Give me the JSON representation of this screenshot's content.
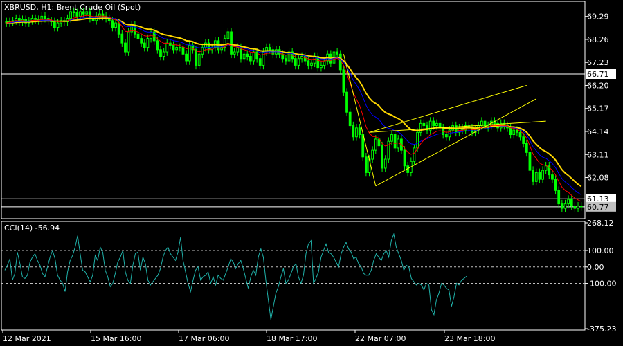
{
  "window": {
    "symbol_label": "XBRUSD, H1:  Brent Crude Oil (Spot)"
  },
  "colors": {
    "background": "#000000",
    "frame": "#ffffff",
    "bull_candle": "#00ff00",
    "bear_candle": "#000000",
    "ma_fast": "#ff0000",
    "ma_mid": "#0000ff",
    "ma_slow": "#ffd700",
    "trendline": "#ffff00",
    "cci_line": "#20b2aa",
    "level_line": "#ffffff",
    "tag_bg": "#ffffff",
    "tag_bg_current": "#c0c0c0"
  },
  "chart_data": [
    {
      "type": "candlestick",
      "panel": "main",
      "ylim": [
        60.3,
        69.9
      ],
      "price_ticks": [
        "69.29",
        "68.26",
        "67.23",
        "66.20",
        "65.17",
        "64.14",
        "63.11",
        "62.08"
      ],
      "time_ticks": [
        "12 Mar 2021",
        "15 Mar 16:00",
        "17 Mar 06:00",
        "18 Mar 17:00",
        "22 Mar 07:00",
        "23 Mar 18:00"
      ],
      "close": [
        69.0,
        69.05,
        69.1,
        69.2,
        69.05,
        69.15,
        69.0,
        69.1,
        69.2,
        69.15,
        69.1,
        69.3,
        69.2,
        69.1,
        69.05,
        68.8,
        69.0,
        69.1,
        69.05,
        69.2,
        69.5,
        69.45,
        69.3,
        69.5,
        69.4,
        69.5,
        69.2,
        69.1,
        69.3,
        69.4,
        69.3,
        69.2,
        69.1,
        68.8,
        69.0,
        68.5,
        68.1,
        67.7,
        68.6,
        68.9,
        68.5,
        68.3,
        68.1,
        67.9,
        68.3,
        68.6,
        68.2,
        67.8,
        67.5,
        67.7,
        68.1,
        68.0,
        67.8,
        67.9,
        67.9,
        67.6,
        67.3,
        68.0,
        67.8,
        67.1,
        67.6,
        67.9,
        68.1,
        67.8,
        67.9,
        68.2,
        67.8,
        67.9,
        68.3,
        68.6,
        67.6,
        67.7,
        67.9,
        67.4,
        67.6,
        67.5,
        67.3,
        67.7,
        67.4,
        67.1,
        67.7,
        67.9,
        67.8,
        67.6,
        67.8,
        67.6,
        67.4,
        67.3,
        67.7,
        67.4,
        67.1,
        67.4,
        67.5,
        67.3,
        67.1,
        67.2,
        67.5,
        67.0,
        67.1,
        67.3,
        67.6,
        67.2,
        67.7,
        67.6,
        66.9,
        65.9,
        65.0,
        64.4,
        63.9,
        64.3,
        64.0,
        63.0,
        62.3,
        62.9,
        63.3,
        63.8,
        63.5,
        62.5,
        62.9,
        63.7,
        64.0,
        63.4,
        63.8,
        63.3,
        62.6,
        62.3,
        62.8,
        63.4,
        64.1,
        64.5,
        64.4,
        64.2,
        64.6,
        64.4,
        64.5,
        64.3,
        64.0,
        63.9,
        64.2,
        64.4,
        64.1,
        64.3,
        64.2,
        64.4,
        64.3,
        64.1,
        64.2,
        64.4,
        64.6,
        64.3,
        64.4,
        64.6,
        64.5,
        64.3,
        64.5,
        64.4,
        64.3,
        64.0,
        64.2,
        64.1,
        63.9,
        63.6,
        63.2,
        62.4,
        61.9,
        62.3,
        62.0,
        62.4,
        62.6,
        62.2,
        62.0,
        61.5,
        60.9,
        60.7,
        60.9,
        61.1,
        60.8,
        60.7,
        60.8,
        60.77
      ],
      "ma_fast": [
        69.0,
        69.03,
        69.06,
        69.1,
        69.09,
        69.1,
        69.08,
        69.08,
        69.11,
        69.12,
        69.12,
        69.15,
        69.16,
        69.15,
        69.13,
        69.07,
        69.06,
        69.07,
        69.07,
        69.09,
        69.16,
        69.22,
        69.24,
        69.29,
        69.31,
        69.34,
        69.32,
        69.28,
        69.29,
        69.31,
        69.31,
        69.29,
        69.26,
        69.17,
        69.14,
        69.02,
        68.84,
        68.62,
        68.61,
        68.66,
        68.64,
        68.59,
        68.51,
        68.42,
        68.4,
        68.44,
        68.4,
        68.3,
        68.17,
        68.09,
        68.09,
        68.07,
        68.03,
        68.01,
        67.99,
        67.93,
        67.84,
        67.87,
        67.86,
        67.74,
        67.71,
        67.74,
        67.8,
        67.8,
        67.82,
        67.88,
        67.86,
        67.87,
        67.94,
        68.05,
        67.97,
        67.93,
        67.92,
        67.84,
        67.8,
        67.76,
        67.69,
        67.69,
        67.65,
        67.56,
        67.58,
        67.63,
        67.65,
        67.64,
        67.66,
        67.65,
        67.6,
        67.55,
        67.58,
        67.55,
        67.48,
        67.46,
        67.47,
        67.44,
        67.39,
        67.36,
        67.38,
        67.32,
        67.29,
        67.29,
        67.34,
        67.32,
        67.38,
        67.41,
        67.33,
        67.09,
        66.73,
        66.3,
        65.88,
        65.58,
        65.29,
        64.86,
        64.35,
        64.07,
        63.92,
        63.9,
        63.84,
        63.6,
        63.49,
        63.54,
        63.64,
        63.6,
        63.63,
        63.56,
        63.39,
        63.21,
        63.12,
        63.17,
        63.36,
        63.59,
        63.76,
        63.86,
        64.0,
        64.07,
        64.15,
        64.17,
        64.14,
        64.1,
        64.12,
        64.17,
        64.16,
        64.19,
        64.19,
        64.23,
        64.25,
        64.22,
        64.22,
        64.25,
        64.32,
        64.32,
        64.34,
        64.4,
        64.42,
        64.4,
        64.42,
        64.41,
        64.39,
        64.3,
        64.28,
        64.23,
        64.16,
        64.04,
        63.85,
        63.5,
        63.12,
        62.93,
        62.73,
        62.65,
        62.63,
        62.53,
        62.41,
        62.2,
        61.9,
        61.65,
        61.5,
        61.42,
        61.28,
        61.16,
        61.08,
        61.01
      ],
      "ma_mid": [
        69.0,
        69.01,
        69.02,
        69.05,
        69.05,
        69.06,
        69.06,
        69.06,
        69.08,
        69.09,
        69.09,
        69.11,
        69.12,
        69.12,
        69.12,
        69.09,
        69.08,
        69.08,
        69.08,
        69.09,
        69.13,
        69.16,
        69.17,
        69.21,
        69.23,
        69.26,
        69.25,
        69.24,
        69.24,
        69.26,
        69.26,
        69.26,
        69.24,
        69.2,
        69.18,
        69.11,
        69.0,
        68.85,
        68.83,
        68.84,
        68.81,
        68.77,
        68.7,
        68.62,
        68.59,
        68.59,
        68.55,
        68.47,
        68.37,
        68.3,
        68.28,
        68.25,
        68.21,
        68.18,
        68.15,
        68.1,
        68.02,
        68.02,
        68.0,
        67.91,
        67.88,
        67.88,
        67.9,
        67.9,
        67.9,
        67.93,
        67.92,
        67.92,
        67.96,
        68.02,
        67.98,
        67.95,
        67.95,
        67.89,
        67.86,
        67.83,
        67.78,
        67.77,
        67.74,
        67.67,
        67.68,
        67.7,
        67.71,
        67.7,
        67.71,
        67.7,
        67.67,
        67.64,
        67.64,
        67.62,
        67.57,
        67.55,
        67.55,
        67.52,
        67.48,
        67.46,
        67.46,
        67.42,
        67.39,
        67.38,
        67.4,
        67.38,
        67.41,
        67.43,
        67.38,
        67.24,
        67.01,
        66.74,
        66.44,
        66.22,
        66.0,
        65.68,
        65.31,
        65.06,
        64.87,
        64.78,
        64.68,
        64.48,
        64.34,
        64.28,
        64.25,
        64.16,
        64.12,
        64.02,
        63.86,
        63.7,
        63.59,
        63.56,
        63.61,
        63.7,
        63.77,
        63.82,
        63.9,
        63.95,
        64.01,
        64.04,
        64.04,
        64.03,
        64.05,
        64.09,
        64.09,
        64.12,
        64.13,
        64.16,
        64.18,
        64.17,
        64.17,
        64.2,
        64.25,
        64.26,
        64.27,
        64.32,
        64.34,
        64.34,
        64.36,
        64.36,
        64.36,
        64.31,
        64.3,
        64.27,
        64.22,
        64.13,
        63.99,
        63.74,
        63.46,
        63.28,
        63.1,
        62.99,
        62.94,
        62.83,
        62.71,
        62.52,
        62.26,
        62.03,
        61.88,
        61.78,
        61.64,
        61.5,
        61.4,
        61.31
      ],
      "ma_slow": [
        69.0,
        69.01,
        69.01,
        69.03,
        69.03,
        69.04,
        69.04,
        69.04,
        69.05,
        69.06,
        69.07,
        69.08,
        69.09,
        69.09,
        69.09,
        69.08,
        69.07,
        69.07,
        69.07,
        69.08,
        69.1,
        69.12,
        69.13,
        69.15,
        69.17,
        69.19,
        69.19,
        69.19,
        69.19,
        69.2,
        69.21,
        69.21,
        69.2,
        69.18,
        69.17,
        69.12,
        69.05,
        68.95,
        68.92,
        68.92,
        68.89,
        68.86,
        68.81,
        68.75,
        68.72,
        68.71,
        68.67,
        68.61,
        68.53,
        68.48,
        68.45,
        68.42,
        68.38,
        68.35,
        68.32,
        68.27,
        68.2,
        68.19,
        68.16,
        68.09,
        68.05,
        68.04,
        68.04,
        68.03,
        68.02,
        68.03,
        68.02,
        68.01,
        68.03,
        68.07,
        68.03,
        68.01,
        68.0,
        67.95,
        67.92,
        67.89,
        67.85,
        67.84,
        67.81,
        67.75,
        67.74,
        67.75,
        67.75,
        67.74,
        67.74,
        67.73,
        67.7,
        67.67,
        67.67,
        67.65,
        67.61,
        67.59,
        67.58,
        67.55,
        67.52,
        67.5,
        67.49,
        67.46,
        67.43,
        67.42,
        67.43,
        67.41,
        67.43,
        67.44,
        67.41,
        67.31,
        67.14,
        66.94,
        66.72,
        66.54,
        66.37,
        66.13,
        65.85,
        65.64,
        65.48,
        65.39,
        65.29,
        65.12,
        64.99,
        64.92,
        64.87,
        64.78,
        64.72,
        64.63,
        64.49,
        64.34,
        64.23,
        64.18,
        64.17,
        64.2,
        64.22,
        64.24,
        64.27,
        64.29,
        64.32,
        64.32,
        64.3,
        64.28,
        64.28,
        64.29,
        64.28,
        64.29,
        64.29,
        64.3,
        64.31,
        64.3,
        64.29,
        64.3,
        64.33,
        64.33,
        64.34,
        64.37,
        64.38,
        64.38,
        64.39,
        64.39,
        64.38,
        64.35,
        64.34,
        64.32,
        64.28,
        64.21,
        64.11,
        63.93,
        63.72,
        63.57,
        63.42,
        63.31,
        63.24,
        63.14,
        63.02,
        62.86,
        62.64,
        62.43,
        62.28,
        62.17,
        62.04,
        61.9,
        61.78,
        61.68
      ],
      "trendlines": [
        {
          "from": [
            105,
            67.6
          ],
          "to": [
            115,
            61.7
          ]
        },
        {
          "from": [
            115,
            61.7
          ],
          "to": [
            165,
            65.6
          ]
        },
        {
          "from": [
            113,
            64.1
          ],
          "to": [
            168,
            64.6
          ]
        },
        {
          "from": [
            113,
            64.1
          ],
          "to": [
            162,
            66.2
          ]
        }
      ],
      "levels": [
        {
          "price": 66.71,
          "tag": "66.71",
          "current": false
        },
        {
          "price": 61.13,
          "tag": "61.13",
          "current": false
        },
        {
          "price": 60.77,
          "tag": "60.77",
          "current": true
        }
      ]
    },
    {
      "type": "line",
      "panel": "indicator",
      "title": "CCI(14) -56.94",
      "ylim": [
        -375.23,
        268.12
      ],
      "ticks": [
        "268.12",
        "100.00",
        "0.00",
        "-100.00",
        "-375.23"
      ],
      "levels": [
        100,
        0,
        -100
      ],
      "values": [
        -20,
        10,
        50,
        -80,
        -40,
        90,
        20,
        -60,
        -70,
        -50,
        30,
        60,
        80,
        40,
        10,
        -40,
        -60,
        0,
        60,
        100,
        50,
        -50,
        -80,
        -100,
        -150,
        -30,
        40,
        70,
        120,
        190,
        80,
        -20,
        -30,
        -60,
        -90,
        -50,
        70,
        40,
        120,
        90,
        -20,
        -60,
        -120,
        -100,
        -40,
        30,
        60,
        100,
        -30,
        -80,
        -100,
        10,
        80,
        90,
        -20,
        60,
        20,
        -80,
        -110,
        -90,
        -70,
        -50,
        -10,
        60,
        100,
        120,
        80,
        60,
        40,
        90,
        180,
        40,
        -30,
        -100,
        -150,
        -80,
        -20,
        0,
        -80,
        -60,
        -50,
        -30,
        -100,
        -60,
        -110,
        -50,
        -70,
        -80,
        -40,
        0,
        50,
        30,
        -10,
        20,
        40,
        -10,
        -70,
        -130,
        -60,
        -20,
        -50,
        60,
        110,
        60,
        -80,
        -200,
        -320,
        -240,
        -160,
        -120,
        -60,
        -10,
        -100,
        -80,
        -40,
        0,
        20,
        -60,
        -100,
        -50,
        80,
        140,
        160,
        -100,
        -70,
        -30,
        60,
        100,
        140,
        90,
        80,
        60,
        30,
        0,
        80,
        120,
        150,
        110,
        90,
        50,
        60,
        20,
        0,
        -40,
        -50,
        -50,
        -20,
        40,
        80,
        60,
        40,
        80,
        100,
        60,
        160,
        200,
        120,
        80,
        40,
        -20,
        10,
        0,
        -70,
        -90,
        -110,
        -100,
        -110,
        -140,
        -100,
        -110,
        -260,
        -290,
        -200,
        -160,
        -100,
        -110,
        -130,
        -140,
        -240,
        -180,
        -100,
        -110,
        -80,
        -70,
        -56.94
      ]
    }
  ]
}
